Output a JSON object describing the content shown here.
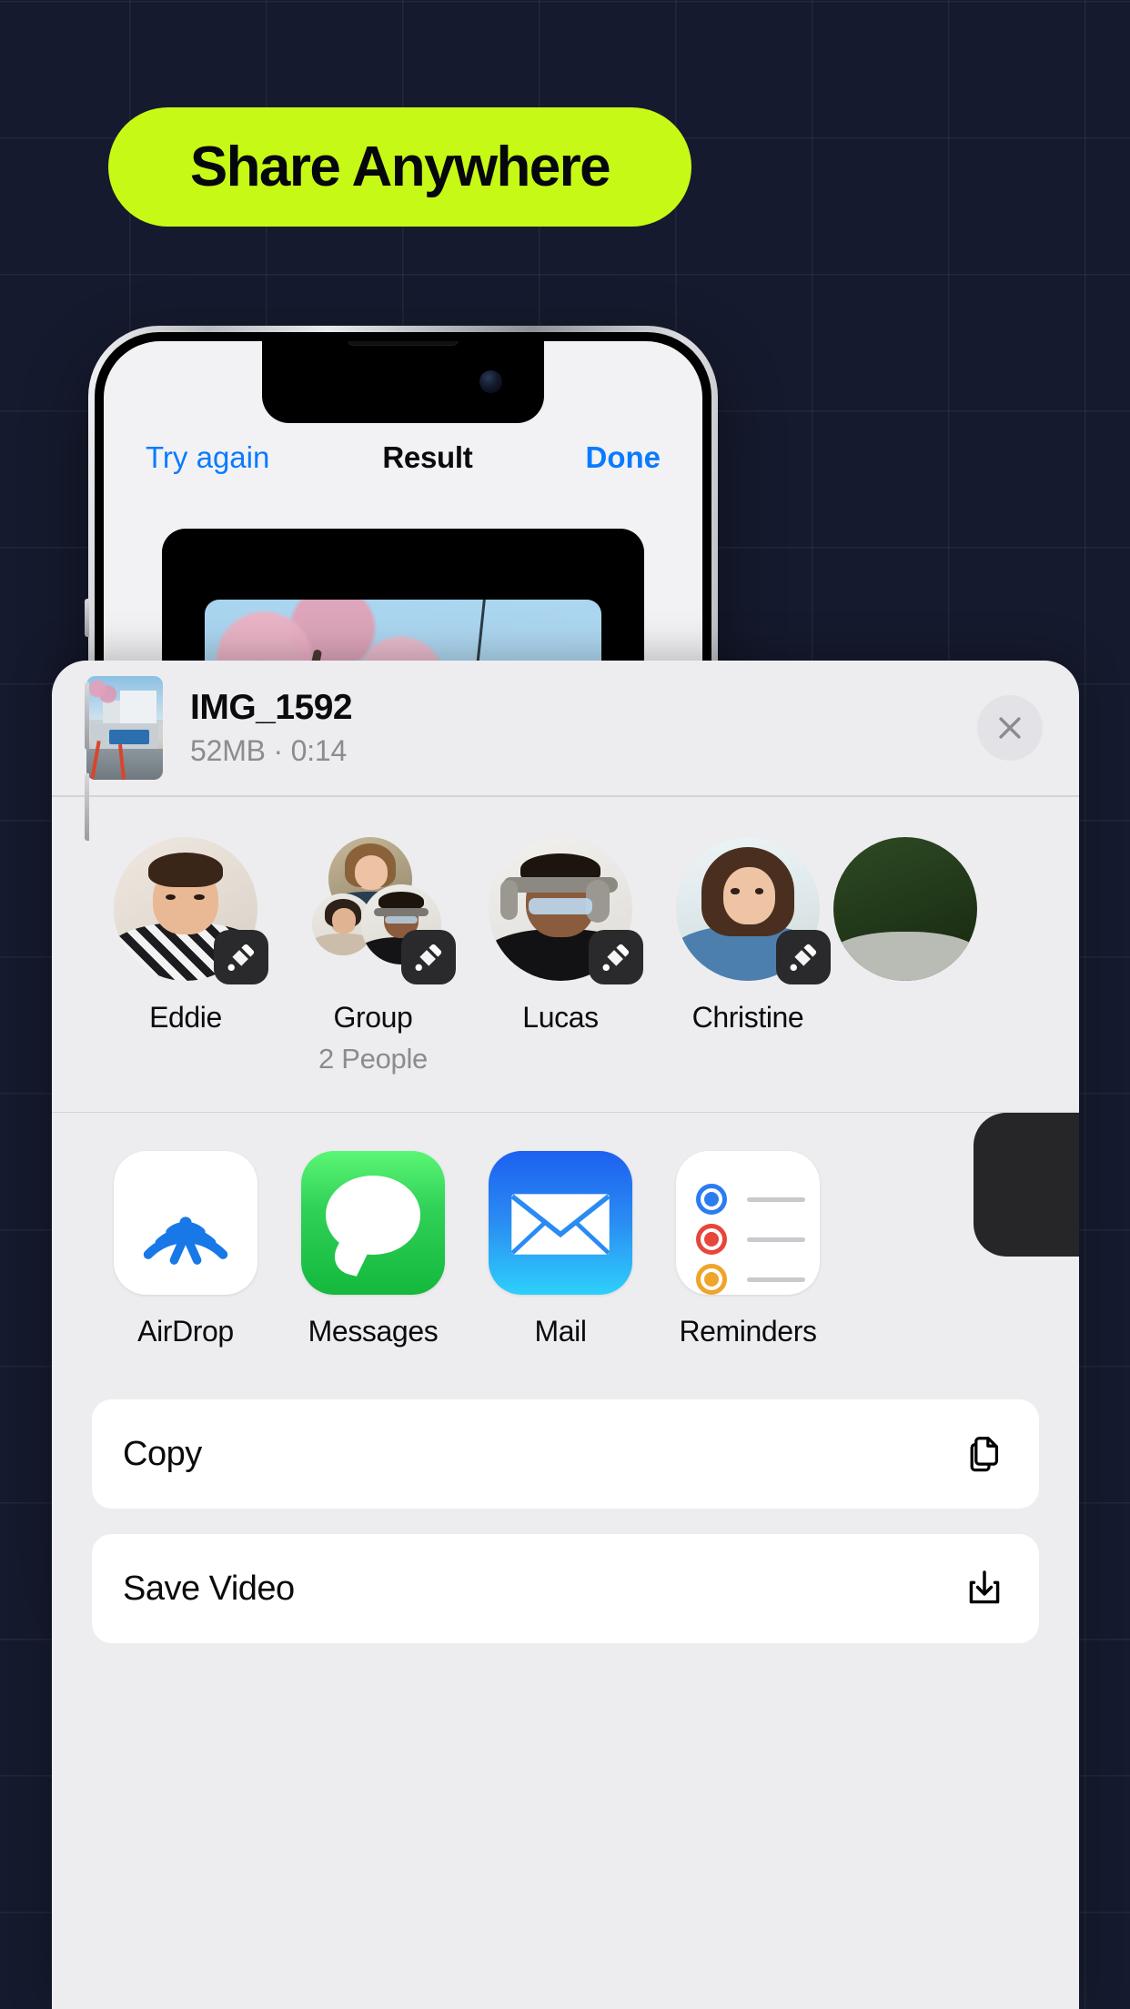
{
  "headline": {
    "text": "Share Anywhere"
  },
  "phone": {
    "nav": {
      "left_label": "Try again",
      "title": "Result",
      "right_label": "Done"
    }
  },
  "share_sheet": {
    "file": {
      "name": "IMG_1592",
      "details": "52MB · 0:14",
      "size": "52MB",
      "duration": "0:14",
      "thumbnail_icon": "video-thumbnail"
    },
    "close_icon": "close-icon",
    "contacts": [
      {
        "name": "Eddie",
        "sub": "",
        "badge_icon": "airdrop-badge-icon"
      },
      {
        "name": "Group",
        "sub": "2 People",
        "badge_icon": "airdrop-badge-icon"
      },
      {
        "name": "Lucas",
        "sub": "",
        "badge_icon": "airdrop-badge-icon"
      },
      {
        "name": "Christine",
        "sub": "",
        "badge_icon": "airdrop-badge-icon"
      }
    ],
    "apps": [
      {
        "name": "AirDrop",
        "icon": "airdrop-icon"
      },
      {
        "name": "Messages",
        "icon": "messages-icon"
      },
      {
        "name": "Mail",
        "icon": "mail-icon"
      },
      {
        "name": "Reminders",
        "icon": "reminders-icon"
      }
    ],
    "actions": [
      {
        "label": "Copy",
        "icon": "copy-icon"
      },
      {
        "label": "Save Video",
        "icon": "save-download-icon"
      }
    ]
  },
  "colors": {
    "background": "#151a2e",
    "accent_pill": "#c6f916",
    "pill_text": "#05070d",
    "ios_blue": "#0a7bff",
    "sheet_bg": "#ededf0",
    "row_bg": "#ffffff",
    "secondary_text": "#8b8b90",
    "badge_bg": "#2a2a2c",
    "messages_green": "#30d158",
    "mail_blue": "#2a8bf2"
  }
}
